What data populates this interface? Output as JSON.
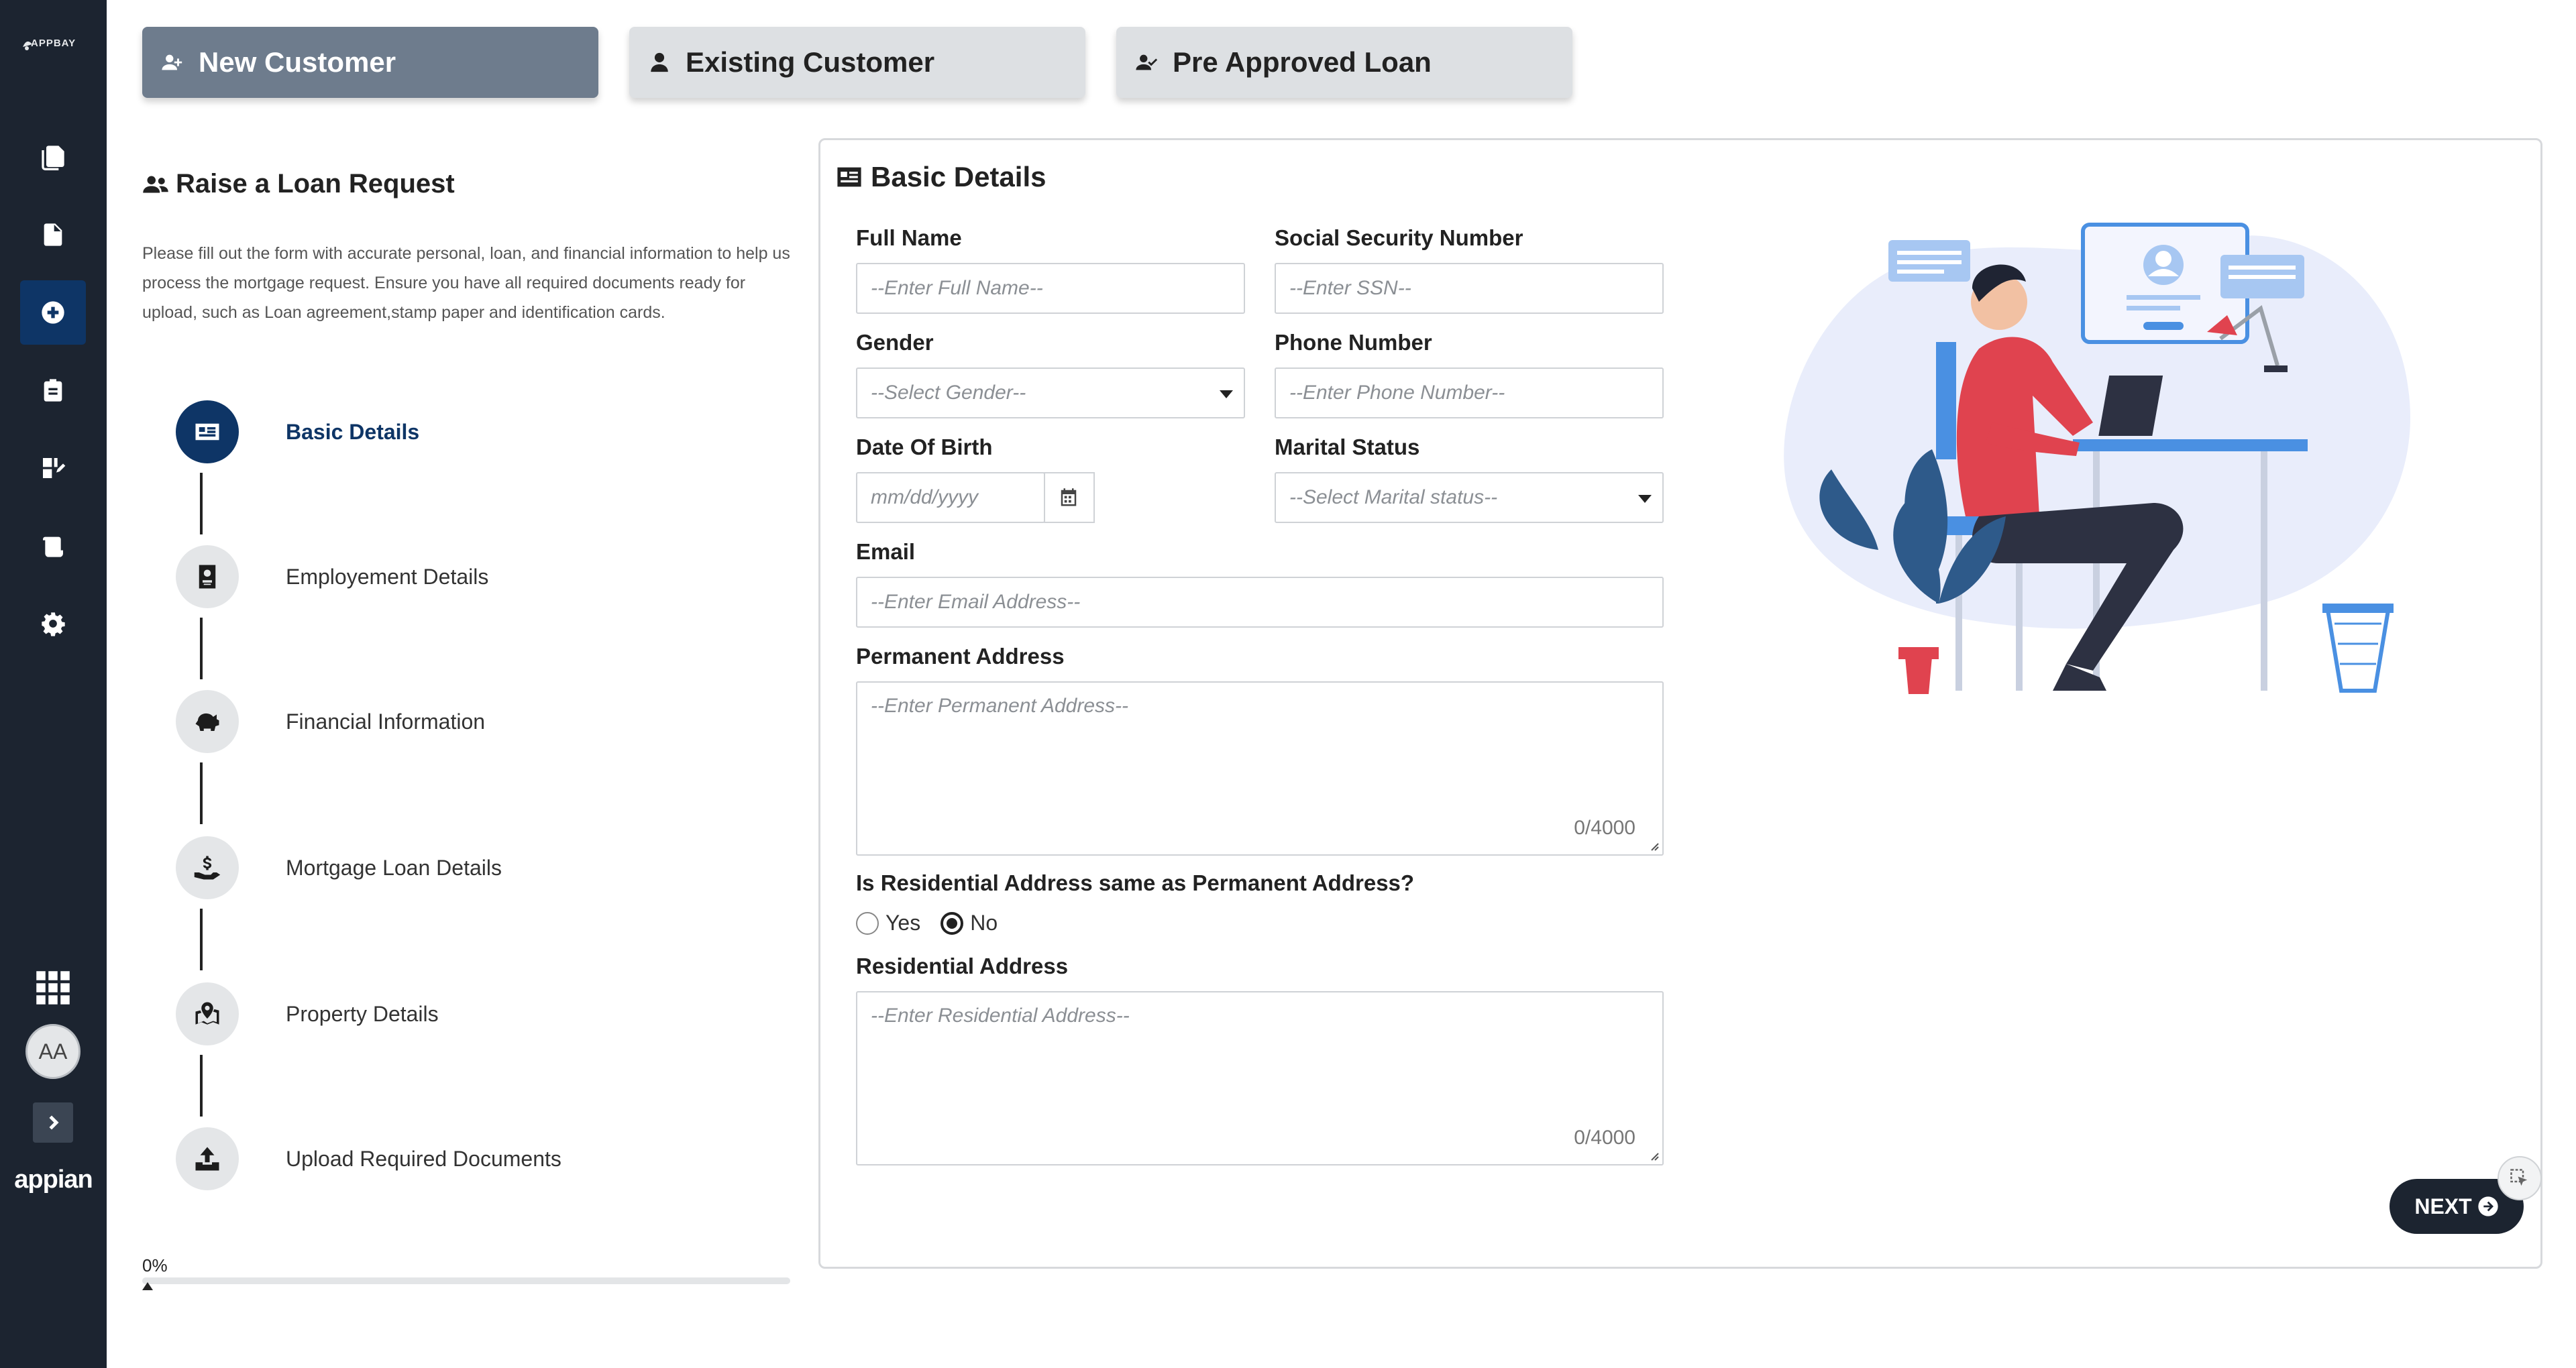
{
  "app": {
    "logo_text": "APPBAY",
    "brand": "appian",
    "avatar_initials": "AA"
  },
  "tabs": [
    {
      "label": "New Customer",
      "active": true
    },
    {
      "label": "Existing Customer",
      "active": false
    },
    {
      "label": "Pre Approved Loan",
      "active": false
    }
  ],
  "left": {
    "title": "Raise a Loan Request",
    "description": "Please fill out the form with accurate personal, loan, and financial information to help us process the mortgage request. Ensure you have all required documents ready for upload, such as Loan agreement,stamp paper and identification cards.",
    "steps": [
      {
        "label": "Basic Details",
        "icon": "id-card-icon",
        "active": true
      },
      {
        "label": "Employement Details",
        "icon": "badge-icon",
        "active": false
      },
      {
        "label": "Financial Information",
        "icon": "piggy-bank-icon",
        "active": false
      },
      {
        "label": "Mortgage Loan Details",
        "icon": "hand-dollar-icon",
        "active": false
      },
      {
        "label": "Property Details",
        "icon": "map-pin-icon",
        "active": false
      },
      {
        "label": "Upload Required Documents",
        "icon": "upload-icon",
        "active": false
      }
    ],
    "progress_text": "0%",
    "progress_value": 0
  },
  "form": {
    "title": "Basic Details",
    "full_name": {
      "label": "Full Name",
      "placeholder": "--Enter Full Name--"
    },
    "ssn": {
      "label": "Social Security Number",
      "placeholder": "--Enter SSN--"
    },
    "gender": {
      "label": "Gender",
      "placeholder": "--Select Gender--"
    },
    "phone": {
      "label": "Phone Number",
      "placeholder": "--Enter Phone Number--"
    },
    "dob": {
      "label": "Date Of Birth",
      "placeholder": "mm/dd/yyyy"
    },
    "marital": {
      "label": "Marital Status",
      "placeholder": "--Select Marital status--"
    },
    "email": {
      "label": "Email",
      "placeholder": "--Enter Email Address--"
    },
    "permanent_address": {
      "label": "Permanent Address",
      "placeholder": "--Enter Permanent Address--",
      "count": "0/4000"
    },
    "same_address": {
      "question": "Is Residential Address same as Permanent Address?",
      "yes": "Yes",
      "no": "No",
      "selected": "No"
    },
    "residential_address": {
      "label": "Residential Address",
      "placeholder": "--Enter Residential Address--",
      "count": "0/4000"
    }
  },
  "actions": {
    "next_label": "NEXT"
  },
  "colors": {
    "rail": "#1c2430",
    "accent": "#0e3566",
    "tab_active": "#6e7c8d",
    "tab_inactive": "#dde0e3",
    "illustration_red": "#e0434f",
    "illustration_blue": "#4a90e2"
  }
}
